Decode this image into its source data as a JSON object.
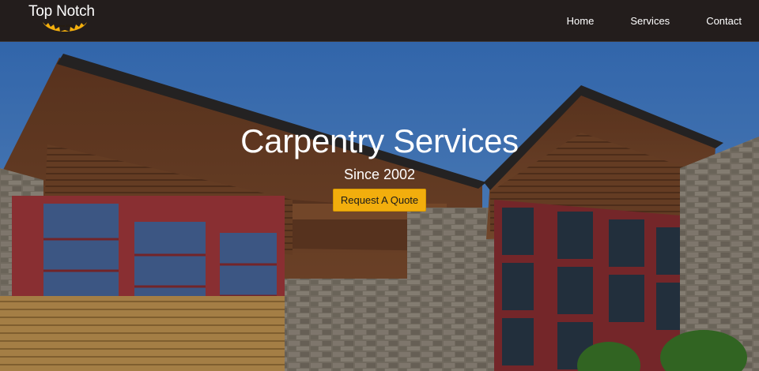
{
  "brand": {
    "name": "Top Notch",
    "tagline": "Since 2002",
    "logo_color": "#f2ae0d"
  },
  "nav": {
    "items": [
      {
        "label": "Home"
      },
      {
        "label": "Services"
      },
      {
        "label": "Contact"
      }
    ]
  },
  "hero": {
    "title": "Carpentry Services",
    "subtitle": "Since 2002",
    "cta_label": "Request A Quote",
    "cta_color": "#f2ae0d"
  }
}
